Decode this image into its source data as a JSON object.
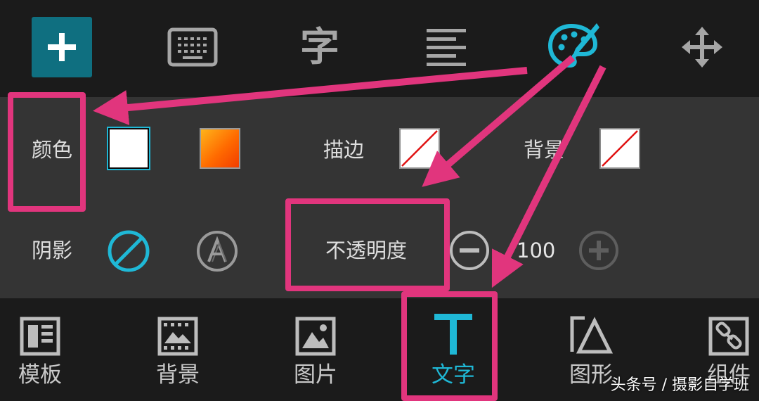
{
  "toolbar": {
    "items": [
      {
        "icon": "plus-icon"
      },
      {
        "icon": "keyboard-icon"
      },
      {
        "icon": "font-glyph-icon",
        "glyph": "字"
      },
      {
        "icon": "align-left-icon"
      },
      {
        "icon": "palette-icon"
      },
      {
        "icon": "move-arrows-icon"
      }
    ]
  },
  "panel": {
    "color_label": "颜色",
    "stroke_label": "描边",
    "background_label": "背景",
    "shadow_label": "阴影",
    "opacity_label": "不透明度",
    "opacity_value": "100"
  },
  "bottom_nav": {
    "items": [
      {
        "label": "模板",
        "icon": "template-icon"
      },
      {
        "label": "背景",
        "icon": "background-image-icon"
      },
      {
        "label": "图片",
        "icon": "picture-icon"
      },
      {
        "label": "文字",
        "icon": "text-icon",
        "active": true
      },
      {
        "label": "图形",
        "icon": "shape-icon"
      },
      {
        "label": "组件",
        "icon": "link-component-icon"
      }
    ]
  },
  "watermark": "头条号 / 摄影自学班",
  "colors": {
    "accent": "#1fb8d6",
    "highlight": "#e1357d",
    "add_button": "#0f6f80",
    "panel": "#343434",
    "background": "#1b1b1b"
  }
}
